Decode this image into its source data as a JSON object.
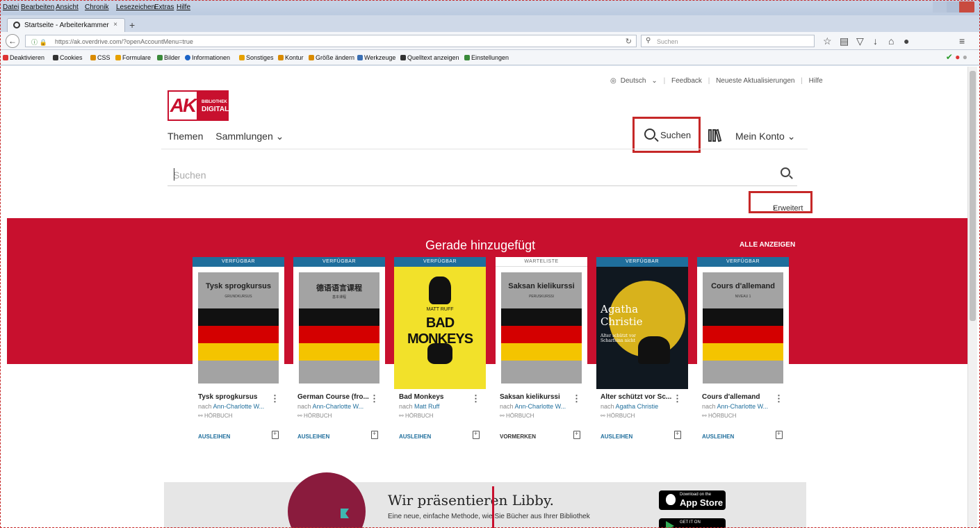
{
  "browser": {
    "menu": [
      "Datei",
      "Bearbeiten",
      "Ansicht",
      "Chronik",
      "Lesezeichen",
      "Extras",
      "Hilfe"
    ],
    "tab_title": "Startseite - Arbeiterkammer",
    "tab_close": "×",
    "new_tab": "+",
    "url": "https://ak.overdrive.com/?openAccountMenu=true",
    "search_placeholder": "Suchen",
    "bookmarks": [
      "Deaktivieren",
      "Cookies",
      "CSS",
      "Formulare",
      "Bilder",
      "Informationen",
      "Sonstiges",
      "Kontur",
      "Größe ändern",
      "Werkzeuge",
      "Quelltext anzeigen",
      "Einstellungen"
    ]
  },
  "utility": {
    "language": "Deutsch",
    "feedback": "Feedback",
    "updates": "Neueste Aktualisierungen",
    "help": "Hilfe"
  },
  "logo": {
    "ak": "AK",
    "line1": "BIBLIOTHEK",
    "line2": "DIGITAL"
  },
  "nav": {
    "themen": "Themen",
    "sammlungen": "Sammlungen",
    "suchen": "Suchen",
    "konto": "Mein Konto"
  },
  "search": {
    "placeholder": "Suchen",
    "advanced": "Erweitert"
  },
  "recent": {
    "title": "Gerade hinzugefügt",
    "view_all": "ALLE ANZEIGEN",
    "books": [
      {
        "status": "VERFÜGBAR",
        "cover_title": "Tysk sprogkursus",
        "cover_sub": "GRUNDKURSUS",
        "title": "Tysk sprogkursus",
        "author_prefix": "nach",
        "author": "Ann-Charlotte W...",
        "format": "HÖRBUCH",
        "action": "AUSLEIHEN"
      },
      {
        "status": "VERFÜGBAR",
        "cover_title": "德语语言课程",
        "cover_sub": "基本课程",
        "title": "German Course (fro...",
        "author_prefix": "nach",
        "author": "Ann-Charlotte W...",
        "format": "HÖRBUCH",
        "action": "AUSLEIHEN"
      },
      {
        "status": "VERFÜGBAR",
        "cover_title": "BAD MONKEYS",
        "cover_sub": "MATT RUFF",
        "title": "Bad Monkeys",
        "author_prefix": "nach",
        "author": "Matt Ruff",
        "format": "HÖRBUCH",
        "action": "AUSLEIHEN"
      },
      {
        "status": "WARTELISTE",
        "cover_title": "Saksan kielikurssi",
        "cover_sub": "PERUSKURSSI",
        "title": "Saksan kielikurssi",
        "author_prefix": "nach",
        "author": "Ann-Charlotte W...",
        "format": "HÖRBUCH",
        "action": "VORMERKEN"
      },
      {
        "status": "VERFÜGBAR",
        "cover_title": "Agatha Christie",
        "cover_sub": "Alter schützt vor Scharfsinn nicht",
        "title": "Alter schützt vor Sc...",
        "author_prefix": "nach",
        "author": "Agatha Christie",
        "format": "HÖRBUCH",
        "action": "AUSLEIHEN"
      },
      {
        "status": "VERFÜGBAR",
        "cover_title": "Cours d'allemand",
        "cover_sub": "NIVEAU 1",
        "title": "Cours d'allemand",
        "author_prefix": "nach",
        "author": "Ann-Charlotte W...",
        "format": "HÖRBUCH",
        "action": "AUSLEIHEN"
      }
    ]
  },
  "libby": {
    "title": "Wir präsentieren Libby.",
    "text": "Eine neue, einfache Methode, wie Sie Bücher aus Ihrer Bibliothek",
    "appstore_small": "Download on the",
    "appstore_big": "App Store",
    "gplay_small": "GET IT ON"
  }
}
